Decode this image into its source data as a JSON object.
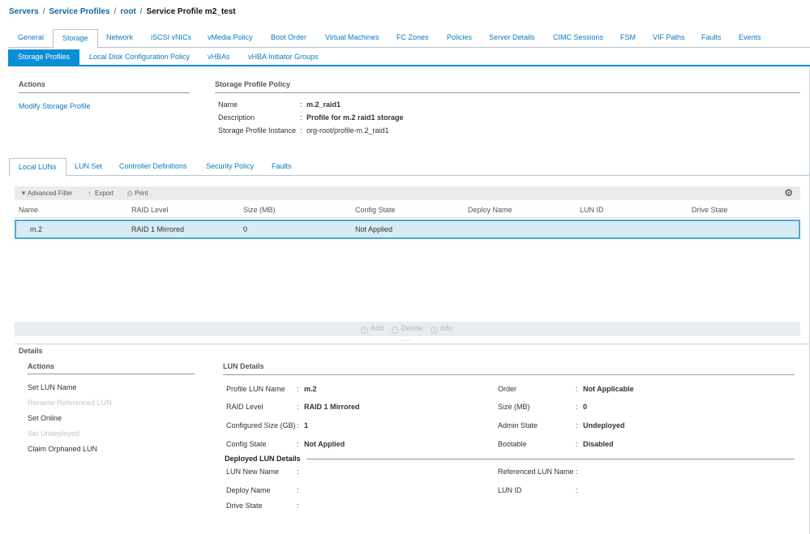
{
  "breadcrumb": {
    "items": [
      "Servers",
      "Service Profiles",
      "root",
      "Service Profile m2_test"
    ],
    "separator": "/"
  },
  "main_tabs": [
    "General",
    "Storage",
    "Network",
    "iSCSI vNICs",
    "vMedia Policy",
    "Boot Order",
    "Virtual Machines",
    "FC Zones",
    "Policies",
    "Server Details",
    "CIMC Sessions",
    "FSM",
    "VIF Paths",
    "Faults",
    "Events"
  ],
  "sub_tabs": [
    "Storage Profiles",
    "Local Disk Configuration Policy",
    "vHBAs",
    "vHBA Initiator Groups"
  ],
  "actions": {
    "title": "Actions",
    "modify": "Modify Storage Profile"
  },
  "policy": {
    "title": "Storage Profile Policy",
    "name_label": "Name",
    "name_value": "m.2_raid1",
    "desc_label": "Description",
    "desc_value": "Profile for m.2 raid1 storage",
    "instance_label": "Storage Profile Instance",
    "instance_value": "org-root/profile-m.2_raid1",
    "colon": ":"
  },
  "lun_tabs": [
    "Local LUNs",
    "LUN Set",
    "Controller Definitions",
    "Security Policy",
    "Faults"
  ],
  "toolbar": {
    "filter": "Advanced Filter",
    "export": "Export",
    "print": "Print",
    "filter_icon": "▼",
    "export_icon": "↑",
    "print_icon": "⎙",
    "settings_icon": "⚙"
  },
  "table": {
    "columns": [
      "Name",
      "RAID Level",
      "Size (MB)",
      "Config State",
      "Deploy Name",
      "LUN ID",
      "Drive State"
    ],
    "rows": [
      {
        "name": "m.2",
        "raid": "RAID 1 Mirrored",
        "size": "0",
        "config": "Not Applied",
        "deploy": "",
        "lun_id": "",
        "drive": ""
      }
    ]
  },
  "table_actions": {
    "add": "Add",
    "delete": "Delete",
    "info": "Info",
    "add_icon": "+",
    "delete_icon": "🗑",
    "info_icon": "i"
  },
  "details": {
    "title": "Details",
    "actions_title": "Actions",
    "actions": [
      {
        "label": "Set LUN Name",
        "enabled": true
      },
      {
        "label": "Rename Referenced LUN",
        "enabled": false
      },
      {
        "label": "Set Online",
        "enabled": true
      },
      {
        "label": "Set Undeployed",
        "enabled": false
      },
      {
        "label": "Claim Orphaned LUN",
        "enabled": true
      }
    ],
    "lun_title": "LUN Details",
    "left_fields": [
      {
        "label": "Profile LUN Name",
        "value": "m.2"
      },
      {
        "label": "RAID Level",
        "value": "RAID 1 Mirrored"
      },
      {
        "label": "Configured Size (GB)",
        "value": "1"
      },
      {
        "label": "Config State",
        "value": "Not Applied"
      }
    ],
    "right_fields": [
      {
        "label": "Order",
        "value": "Not Applicable"
      },
      {
        "label": "Size (MB)",
        "value": "0"
      },
      {
        "label": "Admin State",
        "value": "Undeployed"
      },
      {
        "label": "Bootable",
        "value": "Disabled"
      }
    ],
    "deployed_title": "Deployed LUN Details",
    "deployed_left": [
      {
        "label": "LUN New Name",
        "value": ""
      },
      {
        "label": "Deploy Name",
        "value": ""
      },
      {
        "label": "Drive State",
        "value": ""
      }
    ],
    "deployed_right": [
      {
        "label": "Referenced LUN Name :",
        "value": ""
      },
      {
        "label": "LUN ID",
        "value": ""
      }
    ],
    "colon": ":"
  },
  "colors": {
    "link": "#0a7bbf",
    "active_subtab": "#0a8ed8",
    "selected_row": "#d7ebf5",
    "selected_border": "#52a9d6"
  }
}
